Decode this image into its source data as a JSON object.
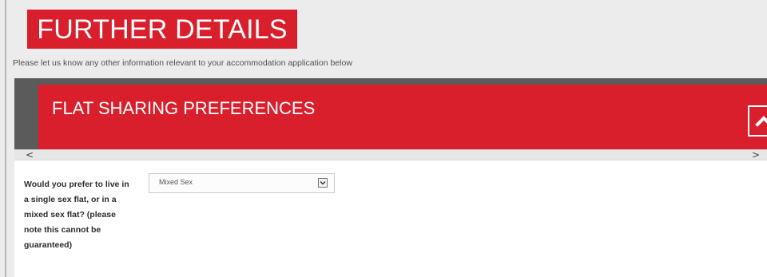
{
  "page": {
    "title": "FURTHER DETAILS",
    "subtitle": "Please let us know any other information relevant to your accommodation application below"
  },
  "section": {
    "title": "FLAT SHARING PREFERENCES",
    "toggle_icon": "chevron-up-icon",
    "scroll_left_icon": "chevron-left-icon",
    "scroll_right_icon": "chevron-right-icon",
    "scroll_left": "<",
    "scroll_right": ">"
  },
  "form": {
    "question": "Would you prefer to live in a single sex flat, or in a mixed sex flat? (please note this cannot be guaranteed)",
    "select_value": "Mixed Sex",
    "select_icon": "chevron-down-icon"
  },
  "colors": {
    "accent_red": "#d91f2c",
    "dark_bar": "#5b5b5b",
    "page_bg": "#ececec",
    "form_bg": "#ffffff"
  }
}
